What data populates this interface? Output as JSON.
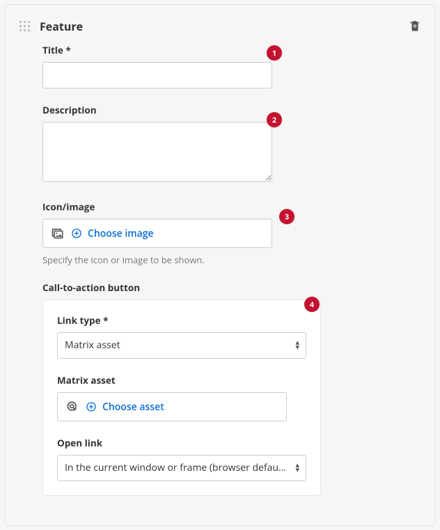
{
  "panel": {
    "title": "Feature"
  },
  "fields": {
    "title": {
      "label": "Title *",
      "value": ""
    },
    "description": {
      "label": "Description",
      "value": ""
    },
    "icon_image": {
      "label": "Icon/image",
      "action": "Choose image",
      "helper": "Specify the icon or image to be shown."
    },
    "cta": {
      "label": "Call-to-action button",
      "link_type": {
        "label": "Link type *",
        "value": "Matrix asset"
      },
      "matrix_asset": {
        "label": "Matrix asset",
        "action": "Choose asset"
      },
      "open_link": {
        "label": "Open link",
        "value": "In the current window or frame (browser default)"
      }
    }
  },
  "annotations": {
    "a1": "1",
    "a2": "2",
    "a3": "3",
    "a4": "4"
  }
}
